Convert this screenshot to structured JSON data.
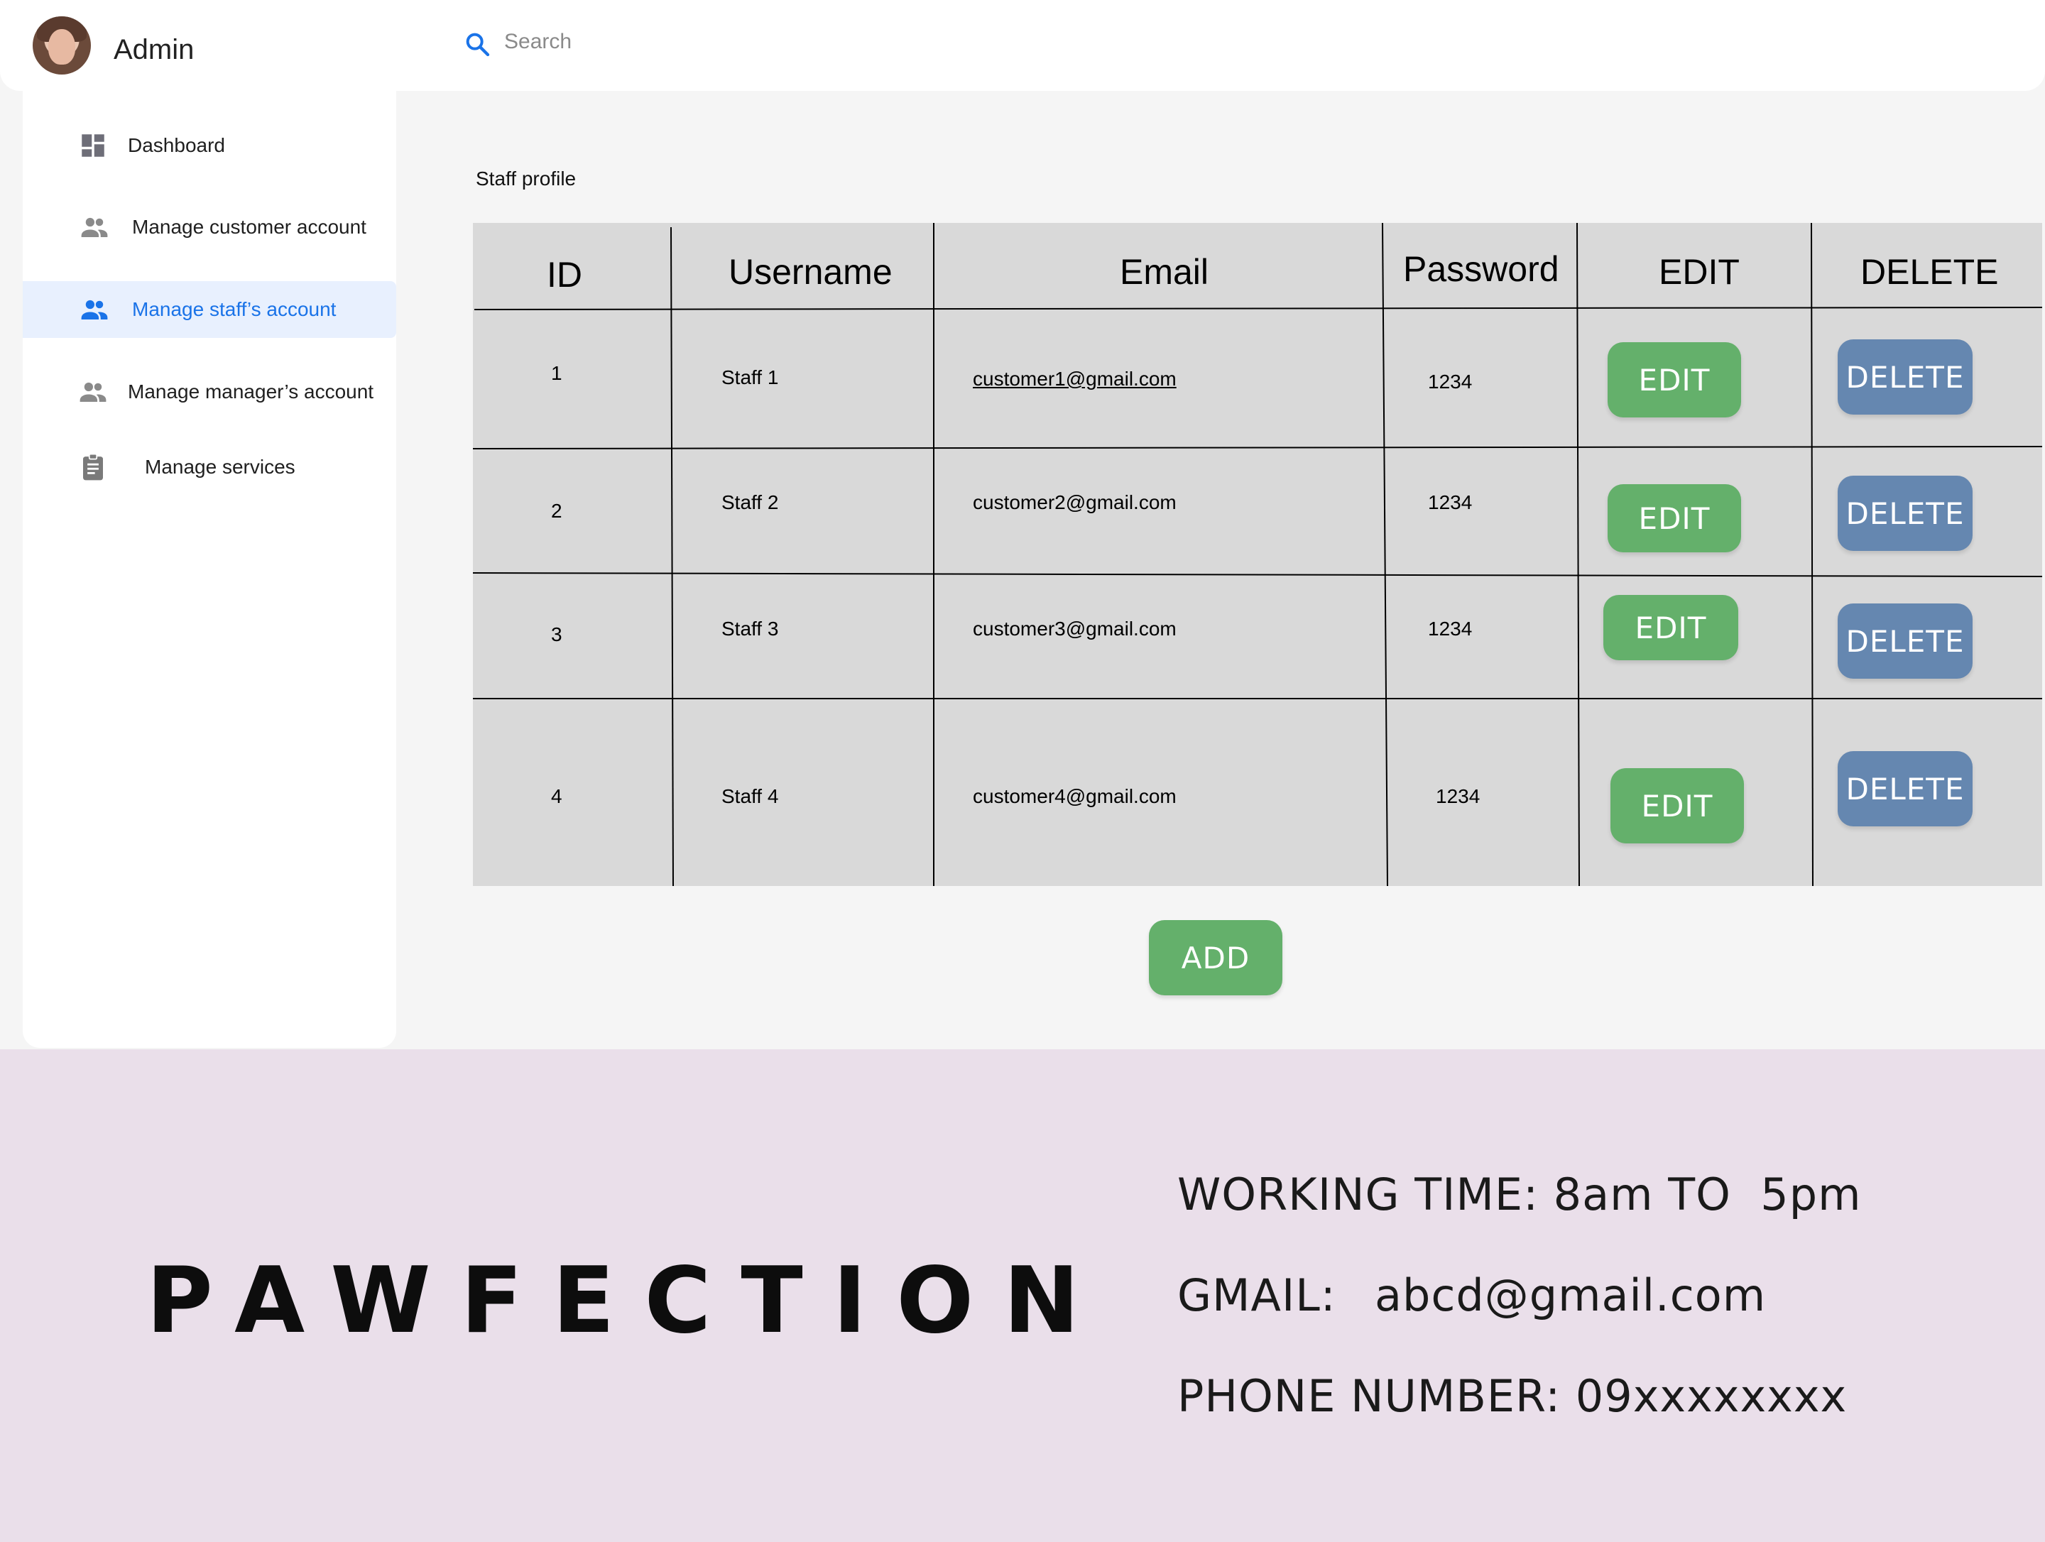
{
  "header": {
    "user_name": "Admin",
    "search_placeholder": "Search"
  },
  "sidebar": {
    "items": [
      {
        "label": "Dashboard",
        "icon": "dashboard-icon",
        "active": false
      },
      {
        "label": "Manage customer account",
        "icon": "people-icon",
        "active": false
      },
      {
        "label": "Manage staff’s account",
        "icon": "people-icon",
        "active": true
      },
      {
        "label": "Manage manager’s account",
        "icon": "people-icon",
        "active": false
      },
      {
        "label": "Manage services",
        "icon": "clipboard-icon",
        "active": false
      }
    ]
  },
  "main": {
    "section_title": "Staff profile",
    "table": {
      "columns": [
        "ID",
        "Username",
        "Email",
        "Password",
        "EDIT",
        "DELETE"
      ],
      "rows": [
        {
          "id": "1",
          "username": "Staff 1",
          "email": "customer1@gmail.com",
          "password": "1234",
          "edit": "EDIT",
          "delete": "DELETE"
        },
        {
          "id": "2",
          "username": "Staff 2",
          "email": "customer2@gmail.com",
          "password": "1234",
          "edit": "EDIT",
          "delete": "DELETE"
        },
        {
          "id": "3",
          "username": "Staff 3",
          "email": "customer3@gmail.com",
          "password": "1234",
          "edit": "EDIT",
          "delete": "DELETE"
        },
        {
          "id": "4",
          "username": "Staff 4",
          "email": "customer4@gmail.com",
          "password": "1234",
          "edit": "EDIT",
          "delete": "DELETE"
        }
      ]
    },
    "add_label": "ADD"
  },
  "footer": {
    "brand": "PAWFECTION",
    "working_time": "WORKING TIME: 8am TO  5pm",
    "gmail_label": "GMAIL:",
    "gmail_value": "abcd@gmail.com",
    "phone": "PHONE NUMBER: 09xxxxxxxx"
  },
  "colors": {
    "accent_blue": "#1a73e8",
    "active_bg": "#e8f0fe",
    "edit_green": "#64b06b",
    "delete_blue": "#6587b0",
    "table_gray": "#d9d9d9",
    "footer_pink": "#eadfea"
  }
}
